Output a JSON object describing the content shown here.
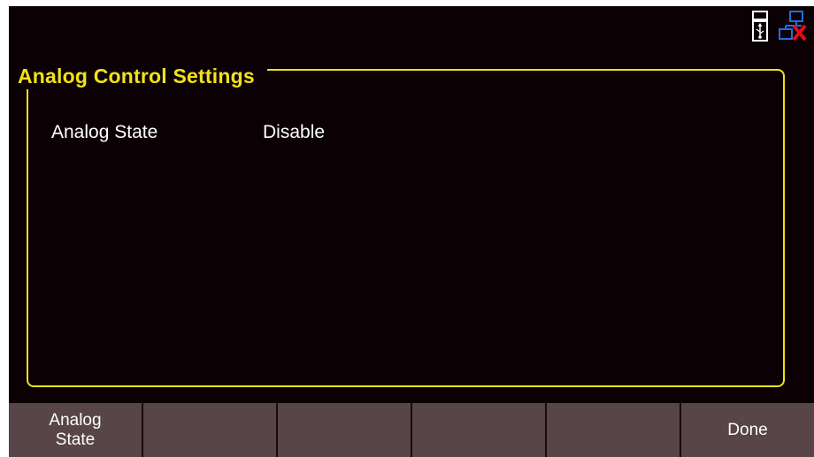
{
  "status": {
    "icons": [
      "usb-storage-icon",
      "network-disconnected-icon"
    ]
  },
  "panel": {
    "title": "Analog Control Settings",
    "rows": [
      {
        "label": "Analog State",
        "value": "Disable"
      }
    ]
  },
  "softkeys": [
    {
      "label": "Analog\nState"
    },
    {
      "label": ""
    },
    {
      "label": ""
    },
    {
      "label": ""
    },
    {
      "label": ""
    },
    {
      "label": "Done"
    }
  ],
  "colors": {
    "background": "#0b0003",
    "accent": "#f2e11b",
    "softkey": "#574548",
    "network_blue": "#1f6fe0",
    "error_red": "#e01010"
  }
}
